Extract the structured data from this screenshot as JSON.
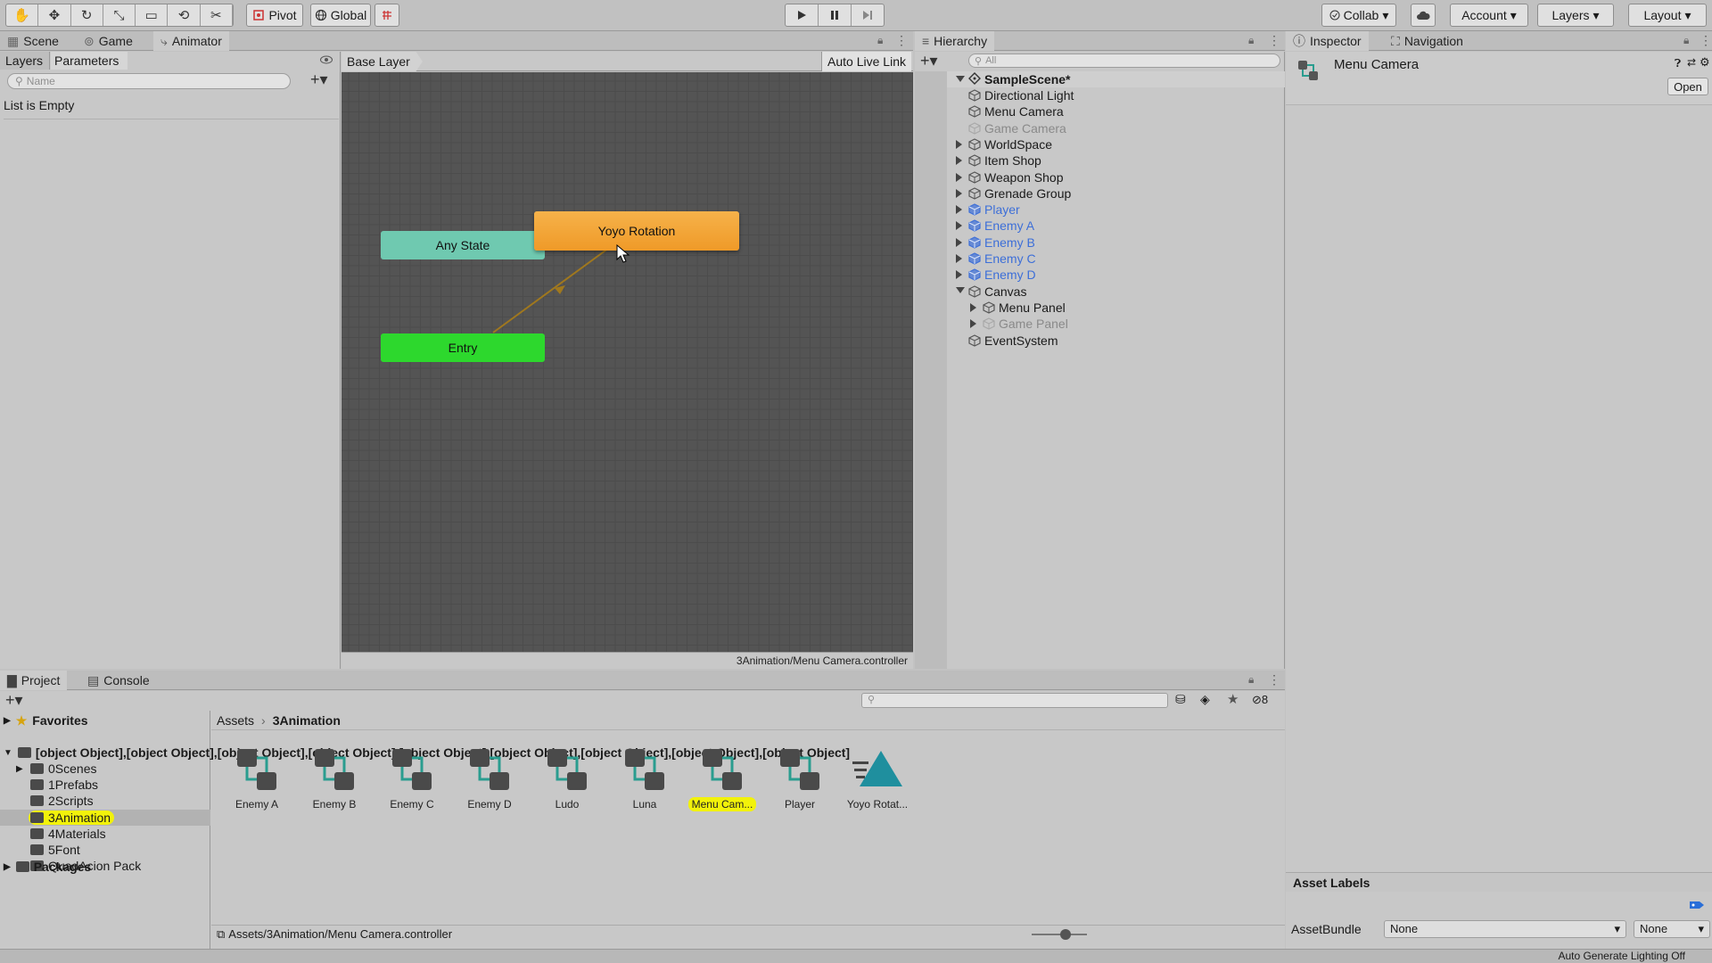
{
  "toolbar": {
    "tool_icons": [
      "hand-icon",
      "move-icon",
      "rotate-icon",
      "scale-icon",
      "rect-icon",
      "transform-icon",
      "custom-tool-icon"
    ],
    "pivot": "Pivot",
    "global": "Global",
    "collab": "Collab",
    "account": "Account",
    "layers": "Layers",
    "layout": "Layout"
  },
  "tabs": {
    "scene": "Scene",
    "game": "Game",
    "animator": "Animator",
    "hierarchy": "Hierarchy",
    "inspector": "Inspector",
    "navigation": "Navigation",
    "project": "Project",
    "console": "Console"
  },
  "animator": {
    "layers_tab": "Layers",
    "parameters_tab": "Parameters",
    "search_placeholder": "Name",
    "empty": "List is Empty",
    "breadcrumb": "Base Layer",
    "live_link": "Auto Live Link",
    "nodes": {
      "any_state": "Any State",
      "yoyo": "Yoyo Rotation",
      "entry": "Entry"
    },
    "footer_path": "3Animation/Menu Camera.controller",
    "colors": {
      "any_state": "#6fc9b0",
      "yoyo": "#ef9a28",
      "entry": "#2dd82d"
    }
  },
  "hierarchy": {
    "search_placeholder": "All",
    "scene": "SampleScene*",
    "items": [
      {
        "label": "Directional Light",
        "depth": 1,
        "exp": "none",
        "style": "normal"
      },
      {
        "label": "Menu Camera",
        "depth": 1,
        "exp": "none",
        "style": "normal"
      },
      {
        "label": "Game Camera",
        "depth": 1,
        "exp": "none",
        "style": "disabled"
      },
      {
        "label": "WorldSpace",
        "depth": 1,
        "exp": "closed",
        "style": "normal"
      },
      {
        "label": "Item Shop",
        "depth": 1,
        "exp": "closed",
        "style": "normal"
      },
      {
        "label": "Weapon Shop",
        "depth": 1,
        "exp": "closed",
        "style": "normal"
      },
      {
        "label": "Grenade Group",
        "depth": 1,
        "exp": "closed",
        "style": "normal"
      },
      {
        "label": "Player",
        "depth": 1,
        "exp": "closed",
        "style": "prefab"
      },
      {
        "label": "Enemy A",
        "depth": 1,
        "exp": "closed",
        "style": "prefab"
      },
      {
        "label": "Enemy B",
        "depth": 1,
        "exp": "closed",
        "style": "prefab"
      },
      {
        "label": "Enemy C",
        "depth": 1,
        "exp": "closed",
        "style": "prefab"
      },
      {
        "label": "Enemy D",
        "depth": 1,
        "exp": "closed",
        "style": "prefab"
      },
      {
        "label": "Canvas",
        "depth": 1,
        "exp": "open",
        "style": "normal"
      },
      {
        "label": "Menu Panel",
        "depth": 2,
        "exp": "closed",
        "style": "normal"
      },
      {
        "label": "Game Panel",
        "depth": 2,
        "exp": "closed",
        "style": "disabled"
      },
      {
        "label": "EventSystem",
        "depth": 1,
        "exp": "none",
        "style": "normal"
      }
    ]
  },
  "inspector": {
    "title": "Menu Camera",
    "open": "Open",
    "asset_labels": "Asset Labels",
    "asset_bundle": "AssetBundle",
    "bundle_value": "None",
    "variant_value": "None",
    "status": "Auto Generate Lighting Off"
  },
  "project": {
    "favorites": "Favorites",
    "assets": [
      {
        "label": "Enemy A",
        "kind": "controller"
      },
      {
        "label": "Enemy B",
        "kind": "controller"
      },
      {
        "label": "Enemy C",
        "kind": "controller"
      },
      {
        "label": "Enemy D",
        "kind": "controller"
      },
      {
        "label": "Ludo",
        "kind": "controller"
      },
      {
        "label": "Luna",
        "kind": "controller"
      },
      {
        "label": "Menu Cam...",
        "kind": "controller",
        "selected": true
      },
      {
        "label": "Player",
        "kind": "controller"
      },
      {
        "label": "Yoyo Rotat...",
        "kind": "clip"
      }
    ],
    "packages": "Packages",
    "hidden_count": "8",
    "folders": [
      {
        "label": "0Scenes",
        "exp": true
      },
      {
        "label": "1Prefabs",
        "exp": false
      },
      {
        "label": "2Scripts",
        "exp": false
      },
      {
        "label": "3Animation",
        "exp": false,
        "selected": true
      },
      {
        "label": "4Materials",
        "exp": false
      },
      {
        "label": "5Font",
        "exp": false
      },
      {
        "label": "QuadAcion Pack",
        "exp": true
      }
    ],
    "breadcrumb_root": "Assets",
    "breadcrumb_current": "3Animation",
    "footer_path": "Assets/3Animation/Menu Camera.controller"
  },
  "colors": {
    "selection_yellow": "#f2f20a",
    "prefab_blue": "#3d6fd8",
    "disabled_gray": "#8a8a8a"
  }
}
